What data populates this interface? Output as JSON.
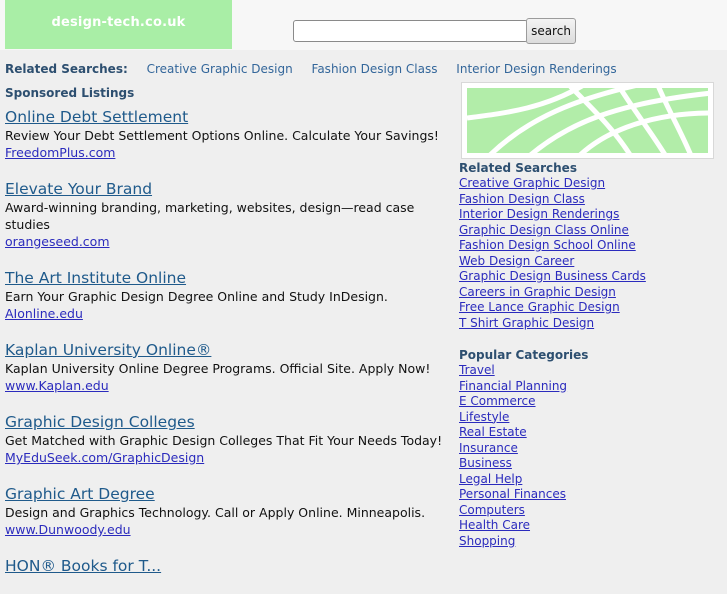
{
  "header": {
    "logo_text": "design-tech.co.uk",
    "search_placeholder": "",
    "search_button_label": "search"
  },
  "related_top": {
    "label": "Related Searches:",
    "links": [
      "Creative Graphic Design",
      "Fashion Design Class",
      "Interior Design Renderings"
    ]
  },
  "sponsored": {
    "label": "Sponsored Listings",
    "listings": [
      {
        "title": "Online Debt Settlement",
        "description": "Review Your Debt Settlement Options Online. Calculate Your Savings!",
        "url": "FreedomPlus.com"
      },
      {
        "title": "Elevate Your Brand",
        "description": "Award-winning branding, marketing, websites, design—read case studies",
        "url": "orangeseed.com"
      },
      {
        "title": "The Art Institute Online",
        "description": "Earn Your Graphic Design Degree Online and Study InDesign.",
        "url": "AIonline.edu"
      },
      {
        "title": "Kaplan University Online®",
        "description": "Kaplan University Online Degree Programs. Official Site. Apply Now!",
        "url": "www.Kaplan.edu"
      },
      {
        "title": "Graphic Design Colleges",
        "description": "Get Matched with Graphic Design Colleges That Fit Your Needs Today!",
        "url": "MyEduSeek.com/GraphicDesign"
      },
      {
        "title": "Graphic Art Degree",
        "description": "Design and Graphics Technology. Call or Apply Online. Minneapolis.",
        "url": "www.Dunwoody.edu"
      },
      {
        "title": "HON® Books for T...",
        "description": "",
        "url": ""
      }
    ]
  },
  "sidebar": {
    "related": {
      "heading": "Related Searches",
      "links": [
        "Creative Graphic Design",
        "Fashion Design Class",
        "Interior Design Renderings",
        "Graphic Design Class Online",
        "Fashion Design School Online",
        "Web Design Career",
        "Graphic Design Business Cards",
        "Careers in Graphic Design",
        "Free Lance Graphic Design",
        "T Shirt Graphic Design"
      ]
    },
    "popular": {
      "heading": "Popular Categories",
      "links": [
        "Travel",
        "Financial Planning",
        "E Commerce",
        "Lifestyle",
        "Real Estate",
        "Insurance",
        "Business",
        "Legal Help",
        "Personal Finances",
        "Computers",
        "Health Care",
        "Shopping"
      ]
    }
  },
  "colors": {
    "logo_bg": "#a9eea6",
    "page_bg": "#efefef",
    "heading": "#2d4f70",
    "link": "#2b2bbd",
    "listing_title": "#1f5a8b"
  }
}
